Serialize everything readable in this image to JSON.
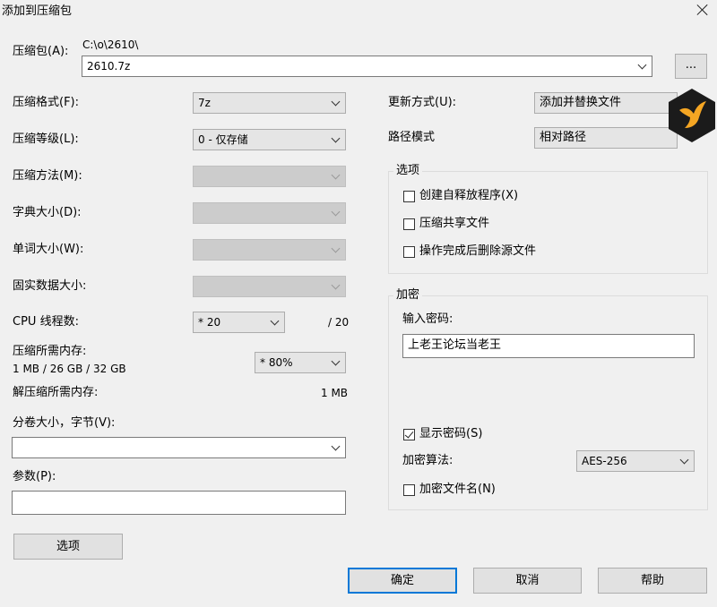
{
  "window": {
    "title": "添加到压缩包"
  },
  "archive": {
    "label": "压缩包(A):",
    "path": "C:\\o\\2610\\",
    "name": "2610.7z",
    "browse_label": "..."
  },
  "left": {
    "format": {
      "label": "压缩格式(F):",
      "value": "7z"
    },
    "level": {
      "label": "压缩等级(L):",
      "value": "0 - 仅存储"
    },
    "method": {
      "label": "压缩方法(M):",
      "value": ""
    },
    "dict": {
      "label": "字典大小(D):",
      "value": ""
    },
    "word": {
      "label": "单词大小(W):",
      "value": ""
    },
    "solid": {
      "label": "固实数据大小:",
      "value": ""
    },
    "cpu": {
      "label": "CPU 线程数:",
      "value": "* 20",
      "max": "/ 20"
    },
    "mem_comp": {
      "label": "压缩所需内存:",
      "detail": "1 MB / 26 GB / 32 GB",
      "value": "* 80%"
    },
    "mem_decomp": {
      "label": "解压缩所需内存:",
      "value": "1 MB"
    },
    "split": {
      "label": "分卷大小，字节(V):",
      "value": ""
    },
    "params": {
      "label": "参数(P):",
      "value": ""
    },
    "options_button": "选项"
  },
  "right": {
    "update": {
      "label": "更新方式(U):",
      "value": "添加并替换文件"
    },
    "pathmode": {
      "label": "路径模式",
      "value": "相对路径"
    },
    "options_group": {
      "title": "选项",
      "sfx": {
        "label": "创建自释放程序(X)",
        "checked": false
      },
      "shared": {
        "label": "压缩共享文件",
        "checked": false
      },
      "delete": {
        "label": "操作完成后删除源文件",
        "checked": false
      }
    },
    "encrypt_group": {
      "title": "加密",
      "password_label": "输入密码:",
      "password_value": "上老王论坛当老王",
      "show_password": {
        "label": "显示密码(S)",
        "checked": true
      },
      "method_label": "加密算法:",
      "method_value": "AES-256",
      "encrypt_names": {
        "label": "加密文件名(N)",
        "checked": false
      }
    }
  },
  "buttons": {
    "ok": "确定",
    "cancel": "取消",
    "help": "帮助"
  },
  "colors": {
    "accent": "#0078d7",
    "logo_bg": "#1b1b1b",
    "logo_bird": "#f5a623"
  }
}
